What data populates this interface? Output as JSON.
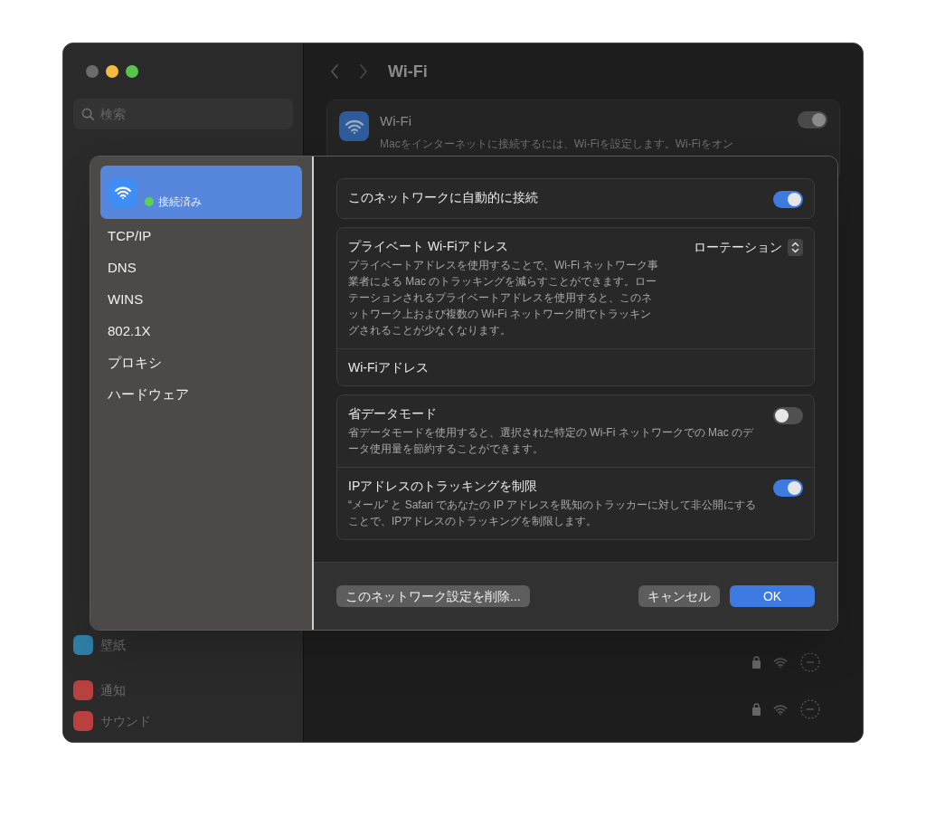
{
  "background": {
    "search_placeholder": "検索",
    "title": "Wi-Fi",
    "sidebar_items": [
      {
        "label": "壁紙",
        "color": "#2f7fa8"
      },
      {
        "label": "通知",
        "color": "#b8403f"
      },
      {
        "label": "サウンド",
        "color": "#b8403f"
      }
    ],
    "wifi_card": {
      "title": "Wi-Fi",
      "description": "Macをインターネットに接続するには、Wi-Fiを設定します。Wi-Fiをオン",
      "on": true
    }
  },
  "dialog": {
    "sidebar": [
      {
        "kind": "network",
        "status": "接続済み",
        "selected": true
      },
      {
        "kind": "text",
        "label": "TCP/IP",
        "selected": false
      },
      {
        "kind": "text",
        "label": "DNS",
        "selected": false
      },
      {
        "kind": "text",
        "label": "WINS",
        "selected": false
      },
      {
        "kind": "text",
        "label": "802.1X",
        "selected": false
      },
      {
        "kind": "text",
        "label": "プロキシ",
        "selected": false
      },
      {
        "kind": "text",
        "label": "ハードウェア",
        "selected": false
      }
    ],
    "sections": [
      [
        {
          "kind": "toggle",
          "title": "このネットワークに自動的に接続",
          "on": true
        }
      ],
      [
        {
          "kind": "select",
          "title": "プライベート Wi-Fiアドレス",
          "description": "プライベートアドレスを使用することで、Wi-Fi ネットワーク事業者による Mac のトラッキングを減らすことができます。ローテーションされるプライベートアドレスを使用すると、このネットワーク上および複数の Wi-Fi ネットワーク間でトラッキングされることが少なくなります。",
          "value": "ローテーション"
        },
        {
          "kind": "label",
          "title": "Wi-Fiアドレス"
        }
      ],
      [
        {
          "kind": "toggle",
          "title": "省データモード",
          "description": "省データモードを使用すると、選択された特定の Wi-Fi ネットワークでの Mac のデータ使用量を節約することができます。",
          "on": false
        },
        {
          "kind": "toggle",
          "title": "IPアドレスのトラッキングを制限",
          "description": "“メール” と Safari であなたの IP アドレスを既知のトラッカーに対して非公開にすることで、IPアドレスのトラッキングを制限します。",
          "on": true
        }
      ]
    ],
    "buttons": [
      {
        "kind": "secondary",
        "label": "このネットワーク設定を削除..."
      },
      {
        "kind": "secondary",
        "label": "キャンセル"
      },
      {
        "kind": "primary",
        "label": "OK"
      }
    ]
  }
}
